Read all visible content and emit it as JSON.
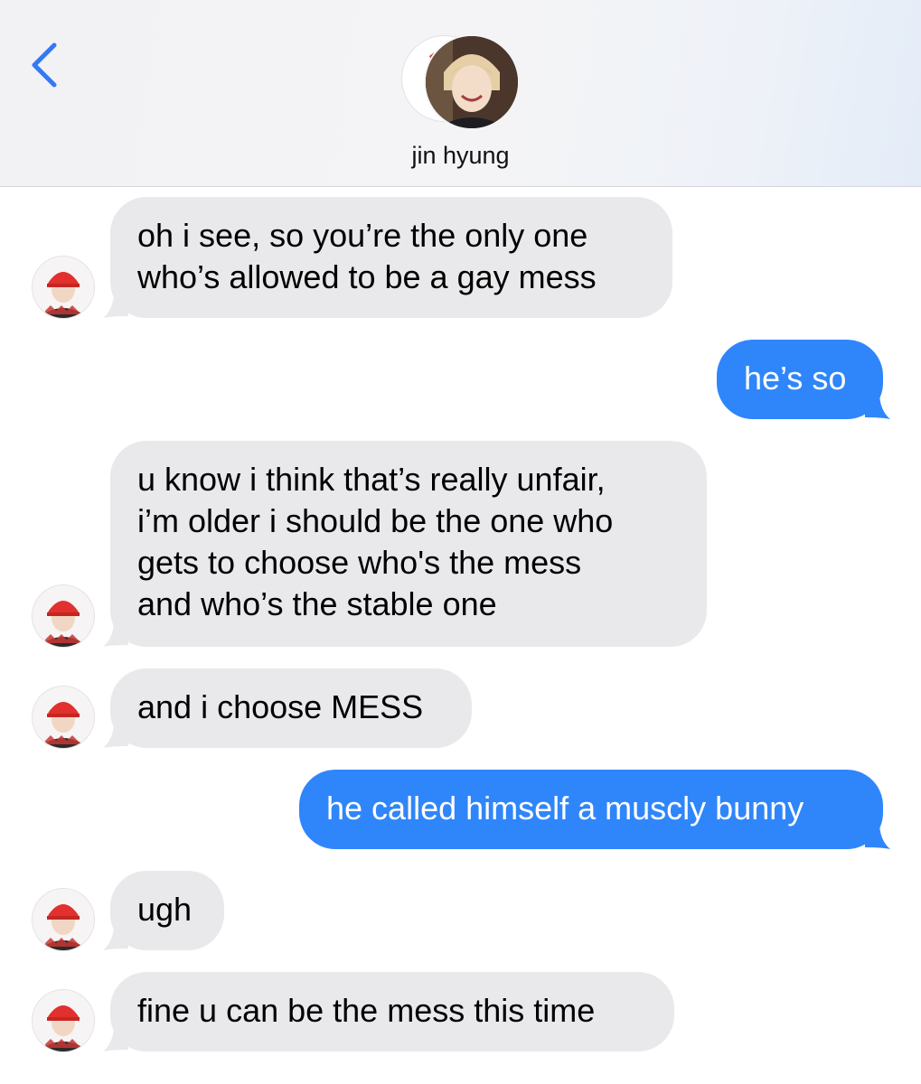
{
  "header": {
    "contact_name": "jin hyung",
    "back_icon": "chevron-left-icon",
    "accent_color": "#3478f6"
  },
  "messages": [
    {
      "direction": "incoming",
      "lines": [
        "oh i see, so you’re the only one",
        "who’s allowed to be a gay mess"
      ]
    },
    {
      "direction": "outgoing",
      "lines": [
        "he’s so"
      ]
    },
    {
      "direction": "incoming",
      "lines": [
        "u know i think that’s really unfair,",
        "i’m older i should be the one who",
        "gets to choose who's the mess",
        "and who’s the stable one"
      ]
    },
    {
      "direction": "incoming",
      "lines": [
        "and i choose MESS"
      ]
    },
    {
      "direction": "outgoing",
      "lines": [
        "he called himself a muscly bunny"
      ]
    },
    {
      "direction": "incoming",
      "lines": [
        "ugh"
      ]
    },
    {
      "direction": "incoming",
      "lines": [
        "fine u can be the mess this time"
      ]
    }
  ],
  "colors": {
    "incoming_bubble": "#e9e9eb",
    "outgoing_bubble": "#2f86fb"
  }
}
